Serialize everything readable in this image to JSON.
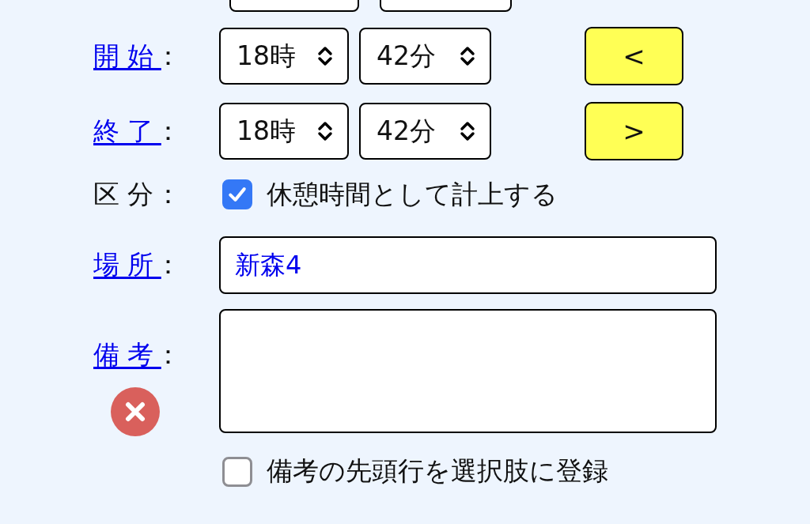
{
  "top_row": [
    {
      "kind": "hour"
    },
    {
      "kind": "minute"
    }
  ],
  "time_rows": [
    {
      "label": "開始",
      "hour": "18時",
      "minute": "42分",
      "button": "<"
    },
    {
      "label": "終了",
      "hour": "18時",
      "minute": "42分",
      "button": ">"
    }
  ],
  "category": {
    "label": "区分",
    "checkbox": {
      "label": "休憩時間として計上する",
      "checked": true
    }
  },
  "place": {
    "label": "場所",
    "value": "新森4"
  },
  "notes": {
    "label": "備考"
  },
  "register_checkbox": {
    "label": "備考の先頭行を選択肢に登録",
    "checked": false
  },
  "colon": "："
}
